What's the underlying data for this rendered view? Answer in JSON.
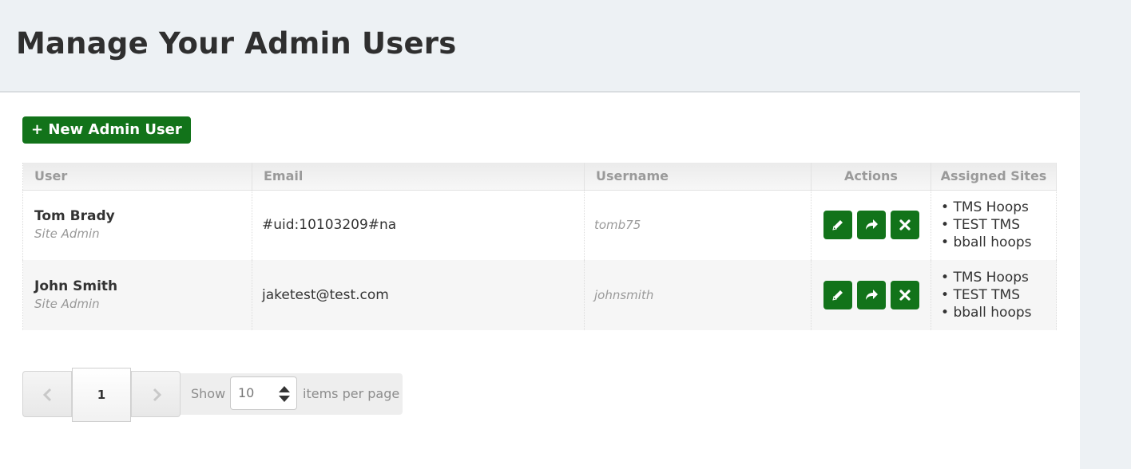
{
  "header": {
    "title": "Manage Your Admin Users"
  },
  "toolbar": {
    "new_user_label": "+ New Admin User"
  },
  "table": {
    "columns": [
      "User",
      "Email",
      "Username",
      "Actions",
      "Assigned Sites"
    ],
    "rows": [
      {
        "name": "Tom Brady",
        "role": "Site Admin",
        "email": "#uid:10103209#na",
        "username": "tomb75",
        "sites": [
          "TMS Hoops",
          "TEST TMS",
          "bball hoops"
        ]
      },
      {
        "name": "John Smith",
        "role": "Site Admin",
        "email": "jaketest@test.com",
        "username": "johnsmith",
        "sites": [
          "TMS Hoops",
          "TEST TMS",
          "bball hoops"
        ]
      }
    ],
    "action_icons": [
      "pencil-icon",
      "share-icon",
      "close-icon"
    ]
  },
  "pagination": {
    "current_page": "1",
    "show_label": "Show",
    "per_page_value": "10",
    "per_page_label": "items per page"
  },
  "colors": {
    "accent": "#12731a",
    "background": "#edf1f4"
  }
}
